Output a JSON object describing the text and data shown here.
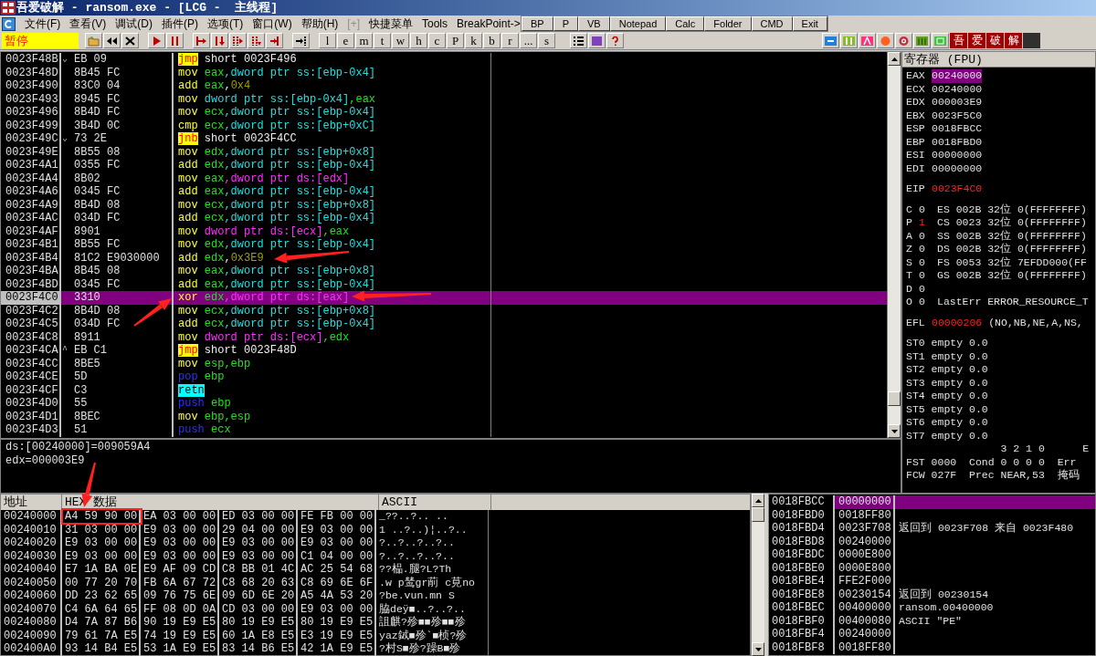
{
  "window": {
    "title": "吾爱破解 - ransom.exe - [LCG -  主线程]"
  },
  "menu": [
    {
      "label": "文件(F)",
      "disabled": false
    },
    {
      "label": "查看(V)",
      "disabled": false
    },
    {
      "label": "调试(D)",
      "disabled": false
    },
    {
      "label": "插件(P)",
      "disabled": false
    },
    {
      "label": "选项(T)",
      "disabled": false
    },
    {
      "label": "窗口(W)",
      "disabled": false
    },
    {
      "label": "帮助(H)",
      "disabled": false
    },
    {
      "label": "[+]",
      "disabled": true
    },
    {
      "label": "快捷菜单",
      "disabled": false
    },
    {
      "label": "Tools",
      "disabled": false
    },
    {
      "label": "BreakPoint->",
      "disabled": false
    }
  ],
  "status": "暂停",
  "letter_buttons": [
    "l",
    "e",
    "m",
    "t",
    "w",
    "h",
    "c",
    "P",
    "k",
    "b",
    "r",
    "...",
    "s"
  ],
  "logo_buttons": [
    "吾",
    "爱",
    "破",
    "解"
  ],
  "quick_buttons": [
    "BP",
    "P",
    "VB",
    "Notepad",
    "Calc",
    "Folder",
    "CMD",
    "Exit"
  ],
  "disassembly": [
    {
      "address": "0023F48B",
      "hex": "EB 09",
      "mark": "⌄",
      "selected": false,
      "ins": [
        {
          "text": "jmp",
          "kind": "jump"
        },
        {
          "text": " short 0023F496",
          "kind": "plain"
        }
      ]
    },
    {
      "address": "0023F48D",
      "hex": "8B45 FC",
      "selected": false,
      "ins": [
        {
          "text": "mov",
          "kind": "mnemonic"
        },
        {
          "text": " eax",
          "kind": "register"
        },
        {
          "text": ",dword ptr ss:[ebp-0x4]",
          "kind": "stackmem"
        }
      ]
    },
    {
      "address": "0023F490",
      "hex": "83C0 04",
      "selected": false,
      "ins": [
        {
          "text": "add",
          "kind": "mnemonic"
        },
        {
          "text": " eax",
          "kind": "register"
        },
        {
          "text": ",",
          "kind": "plain"
        },
        {
          "text": "0x4",
          "kind": "number"
        }
      ]
    },
    {
      "address": "0023F493",
      "hex": "8945 FC",
      "selected": false,
      "ins": [
        {
          "text": "mov",
          "kind": "mnemonic"
        },
        {
          "text": " dword ptr ss:[ebp-0x4]",
          "kind": "stackmem"
        },
        {
          "text": ",eax",
          "kind": "register"
        }
      ]
    },
    {
      "address": "0023F496",
      "hex": "8B4D FC",
      "selected": false,
      "ins": [
        {
          "text": "mov",
          "kind": "mnemonic"
        },
        {
          "text": " ecx",
          "kind": "register"
        },
        {
          "text": ",dword ptr ss:[ebp-0x4]",
          "kind": "stackmem"
        }
      ]
    },
    {
      "address": "0023F499",
      "hex": "3B4D 0C",
      "selected": false,
      "ins": [
        {
          "text": "cmp",
          "kind": "mnemonic"
        },
        {
          "text": " ecx",
          "kind": "register"
        },
        {
          "text": ",dword ptr ss:[ebp+0xC]",
          "kind": "stackmem"
        }
      ]
    },
    {
      "address": "0023F49C",
      "hex": "73 2E",
      "mark": "⌄",
      "selected": false,
      "ins": [
        {
          "text": "jnb",
          "kind": "jump"
        },
        {
          "text": " short 0023F4CC",
          "kind": "plain"
        }
      ]
    },
    {
      "address": "0023F49E",
      "hex": "8B55 08",
      "selected": false,
      "ins": [
        {
          "text": "mov",
          "kind": "mnemonic"
        },
        {
          "text": " edx",
          "kind": "register"
        },
        {
          "text": ",dword ptr ss:[ebp+0x8]",
          "kind": "stackmem"
        }
      ]
    },
    {
      "address": "0023F4A1",
      "hex": "0355 FC",
      "selected": false,
      "ins": [
        {
          "text": "add",
          "kind": "mnemonic"
        },
        {
          "text": " edx",
          "kind": "register"
        },
        {
          "text": ",dword ptr ss:[ebp-0x4]",
          "kind": "stackmem"
        }
      ]
    },
    {
      "address": "0023F4A4",
      "hex": "8B02",
      "selected": false,
      "ins": [
        {
          "text": "mov",
          "kind": "mnemonic"
        },
        {
          "text": " eax",
          "kind": "register"
        },
        {
          "text": ",dword ptr ds:[edx]",
          "kind": "datamem"
        }
      ]
    },
    {
      "address": "0023F4A6",
      "hex": "0345 FC",
      "selected": false,
      "ins": [
        {
          "text": "add",
          "kind": "mnemonic"
        },
        {
          "text": " eax",
          "kind": "register"
        },
        {
          "text": ",dword ptr ss:[ebp-0x4]",
          "kind": "stackmem"
        }
      ]
    },
    {
      "address": "0023F4A9",
      "hex": "8B4D 08",
      "selected": false,
      "ins": [
        {
          "text": "mov",
          "kind": "mnemonic"
        },
        {
          "text": " ecx",
          "kind": "register"
        },
        {
          "text": ",dword ptr ss:[ebp+0x8]",
          "kind": "stackmem"
        }
      ]
    },
    {
      "address": "0023F4AC",
      "hex": "034D FC",
      "selected": false,
      "ins": [
        {
          "text": "add",
          "kind": "mnemonic"
        },
        {
          "text": " ecx",
          "kind": "register"
        },
        {
          "text": ",dword ptr ss:[ebp-0x4]",
          "kind": "stackmem"
        }
      ]
    },
    {
      "address": "0023F4AF",
      "hex": "8901",
      "selected": false,
      "ins": [
        {
          "text": "mov",
          "kind": "mnemonic"
        },
        {
          "text": " dword ptr ds:[ecx]",
          "kind": "datamem"
        },
        {
          "text": ",eax",
          "kind": "register"
        }
      ]
    },
    {
      "address": "0023F4B1",
      "hex": "8B55 FC",
      "selected": false,
      "ins": [
        {
          "text": "mov",
          "kind": "mnemonic"
        },
        {
          "text": " edx",
          "kind": "register"
        },
        {
          "text": ",dword ptr ss:[ebp-0x4]",
          "kind": "stackmem"
        }
      ]
    },
    {
      "address": "0023F4B4",
      "hex": "81C2 E9030000",
      "selected": false,
      "ins": [
        {
          "text": "add",
          "kind": "mnemonic"
        },
        {
          "text": " edx",
          "kind": "register"
        },
        {
          "text": ",",
          "kind": "plain"
        },
        {
          "text": "0x3E9",
          "kind": "number"
        }
      ]
    },
    {
      "address": "0023F4BA",
      "hex": "8B45 08",
      "selected": false,
      "ins": [
        {
          "text": "mov",
          "kind": "mnemonic"
        },
        {
          "text": " eax",
          "kind": "register"
        },
        {
          "text": ",dword ptr ss:[ebp+0x8]",
          "kind": "stackmem"
        }
      ]
    },
    {
      "address": "0023F4BD",
      "hex": "0345 FC",
      "selected": false,
      "ins": [
        {
          "text": "add",
          "kind": "mnemonic"
        },
        {
          "text": " eax",
          "kind": "register"
        },
        {
          "text": ",dword ptr ss:[ebp-0x4]",
          "kind": "stackmem"
        }
      ]
    },
    {
      "address": "0023F4C0",
      "hex": "3310",
      "selected": true,
      "ins": [
        {
          "text": "xor",
          "kind": "mnemonic"
        },
        {
          "text": " edx",
          "kind": "register"
        },
        {
          "text": ",dword ptr ds:[eax]",
          "kind": "datamem"
        }
      ]
    },
    {
      "address": "0023F4C2",
      "hex": "8B4D 08",
      "selected": false,
      "ins": [
        {
          "text": "mov",
          "kind": "mnemonic"
        },
        {
          "text": " ecx",
          "kind": "register"
        },
        {
          "text": ",dword ptr ss:[ebp+0x8]",
          "kind": "stackmem"
        }
      ]
    },
    {
      "address": "0023F4C5",
      "hex": "034D FC",
      "selected": false,
      "ins": [
        {
          "text": "add",
          "kind": "mnemonic"
        },
        {
          "text": " ecx",
          "kind": "register"
        },
        {
          "text": ",dword ptr ss:[ebp-0x4]",
          "kind": "stackmem"
        }
      ]
    },
    {
      "address": "0023F4C8",
      "hex": "8911",
      "selected": false,
      "ins": [
        {
          "text": "mov",
          "kind": "mnemonic"
        },
        {
          "text": " dword ptr ds:[ecx]",
          "kind": "datamem"
        },
        {
          "text": ",edx",
          "kind": "register"
        }
      ]
    },
    {
      "address": "0023F4CA",
      "hex": "EB C1",
      "mark": "^",
      "selected": false,
      "ins": [
        {
          "text": "jmp",
          "kind": "jump"
        },
        {
          "text": " short 0023F48D",
          "kind": "plain"
        }
      ]
    },
    {
      "address": "0023F4CC",
      "hex": "8BE5",
      "selected": false,
      "ins": [
        {
          "text": "mov",
          "kind": "mnemonic"
        },
        {
          "text": " esp,ebp",
          "kind": "register"
        }
      ]
    },
    {
      "address": "0023F4CE",
      "hex": "5D",
      "selected": false,
      "ins": [
        {
          "text": "pop",
          "kind": "stackop"
        },
        {
          "text": " ebp",
          "kind": "register"
        }
      ]
    },
    {
      "address": "0023F4CF",
      "hex": "C3",
      "selected": false,
      "ins": [
        {
          "text": "retn",
          "kind": "return"
        }
      ]
    },
    {
      "address": "0023F4D0",
      "hex": "55",
      "selected": false,
      "ins": [
        {
          "text": "push",
          "kind": "stackop"
        },
        {
          "text": " ebp",
          "kind": "register"
        }
      ]
    },
    {
      "address": "0023F4D1",
      "hex": "8BEC",
      "selected": false,
      "ins": [
        {
          "text": "mov",
          "kind": "mnemonic"
        },
        {
          "text": " ebp,esp",
          "kind": "register"
        }
      ]
    },
    {
      "address": "0023F4D3",
      "hex": "51",
      "selected": false,
      "ins": [
        {
          "text": "push",
          "kind": "stackop"
        },
        {
          "text": " ecx",
          "kind": "register"
        }
      ]
    }
  ],
  "info": [
    "ds:[00240000]=009059A4",
    "edx=000003E9"
  ],
  "registers": {
    "title": "寄存器 (FPU)",
    "general": [
      {
        "name": "EAX",
        "value": "00240000",
        "selected": true,
        "changed": false
      },
      {
        "name": "ECX",
        "value": "00240000",
        "selected": false,
        "changed": false
      },
      {
        "name": "EDX",
        "value": "000003E9",
        "selected": false,
        "changed": false
      },
      {
        "name": "EBX",
        "value": "0023F5C0",
        "selected": false,
        "changed": false
      },
      {
        "name": "ESP",
        "value": "0018FBCC",
        "selected": false,
        "changed": false
      },
      {
        "name": "EBP",
        "value": "0018FBD0",
        "selected": false,
        "changed": false
      },
      {
        "name": "ESI",
        "value": "00000000",
        "selected": false,
        "changed": false
      },
      {
        "name": "EDI",
        "value": "00000000",
        "selected": false,
        "changed": false
      }
    ],
    "eip": {
      "name": "EIP",
      "value": "0023F4C0",
      "selected": false,
      "changed": true
    },
    "flags": [
      {
        "flag": "C",
        "value": "0",
        "changed": false,
        "detail": "ES 002B 32位 0(FFFFFFFF)"
      },
      {
        "flag": "P",
        "value": "1",
        "changed": true,
        "detail": "CS 0023 32位 0(FFFFFFFF)"
      },
      {
        "flag": "A",
        "value": "0",
        "changed": false,
        "detail": "SS 002B 32位 0(FFFFFFFF)"
      },
      {
        "flag": "Z",
        "value": "0",
        "changed": false,
        "detail": "DS 002B 32位 0(FFFFFFFF)"
      },
      {
        "flag": "S",
        "value": "0",
        "changed": false,
        "detail": "FS 0053 32位 7EFDD000(FF"
      },
      {
        "flag": "T",
        "value": "0",
        "changed": false,
        "detail": "GS 002B 32位 0(FFFFFFFF)"
      },
      {
        "flag": "D",
        "value": "0",
        "changed": false
      },
      {
        "flag": "O",
        "value": "0",
        "changed": false,
        "detail": "LastErr ERROR_RESOURCE_T"
      }
    ],
    "efl": {
      "name": "EFL",
      "value": "00000206",
      "changed": true,
      "detail": "(NO,NB,NE,A,NS,"
    },
    "fpu_stack": [
      "ST0 empty 0.0",
      "ST1 empty 0.0",
      "ST2 empty 0.0",
      "ST3 empty 0.0",
      "ST4 empty 0.0",
      "ST5 empty 0.0",
      "ST6 empty 0.0",
      "ST7 empty 0.0"
    ],
    "fpu_status": [
      "               3 2 1 0      E",
      "FST 0000  Cond 0 0 0 0  Err",
      "FCW 027F  Prec NEAR,53  掩码"
    ]
  },
  "dump": {
    "columns": [
      "地址",
      "HEX 数据",
      "ASCII"
    ],
    "rows": [
      {
        "address": "00240000",
        "hex": [
          "A4 59 90 00",
          "EA 03 00 00",
          "ED 03 00 00",
          "FE FB 00 00"
        ],
        "ascii": "_??..?..  .."
      },
      {
        "address": "00240010",
        "hex": [
          "31 03 00 00",
          "E9 03 00 00",
          "29 04 00 00",
          "E9 03 00 00"
        ],
        "ascii": "1 ..?..)¦..?.."
      },
      {
        "address": "00240020",
        "hex": [
          "E9 03 00 00",
          "E9 03 00 00",
          "E9 03 00 00",
          "E9 03 00 00"
        ],
        "ascii": "?..?..?..?.."
      },
      {
        "address": "00240030",
        "hex": [
          "E9 03 00 00",
          "E9 03 00 00",
          "E9 03 00 00",
          "C1 04 00 00"
        ],
        "ascii": "?..?..?..?.."
      },
      {
        "address": "00240040",
        "hex": [
          "E7 1A BA 0E",
          "E9 AF 09 CD",
          "C8 BB 01 4C",
          "AC 25 54 68"
        ],
        "ascii": "??榀.腿?L?Th"
      },
      {
        "address": "00240050",
        "hex": [
          "00 77 20 70",
          "FB 6A 67 72",
          "C8 68 20 63",
          "C8 69 6E 6F"
        ],
        "ascii": ".w p鸶gr萷 c莧no"
      },
      {
        "address": "00240060",
        "hex": [
          "DD 23 62 65",
          "09 76 75 6E",
          "09 6D 6E 20",
          "A5 4A 53 20"
        ],
        "ascii": "?be.vun.mn   S"
      },
      {
        "address": "00240070",
        "hex": [
          "C4 6A 64 65",
          "FF 08 0D 0A",
          "CD 03 00 00",
          "E9 03 00 00"
        ],
        "ascii": "脇deÿ■..?..?.."
      },
      {
        "address": "00240080",
        "hex": [
          "D4 7A 87 B6",
          "90 19 E9 E5",
          "80 19 E9 E5",
          "80 19 E9 E5"
        ],
        "ascii": "詛麒?殄■■殄■■殄"
      },
      {
        "address": "00240090",
        "hex": [
          "79 61 7A E5",
          "74 19 E9 E5",
          "60 1A E8 E5",
          "E3 19 E9 E5"
        ],
        "ascii": "yaz鋱■殄`■桢?殄"
      },
      {
        "address": "002400A0",
        "hex": [
          "93 14 B4 E5",
          "53 1A E9 E5",
          "83 14 B6 E5",
          "42 1A E9 E5"
        ],
        "ascii": "?村S■殄?躁B■殄"
      }
    ]
  },
  "stack": [
    {
      "address": "0018FBCC",
      "value": "00000000",
      "selected": true
    },
    {
      "address": "0018FBD0",
      "value": "0018FF80",
      "selected": false
    },
    {
      "address": "0018FBD4",
      "value": "0023F708",
      "comment": "返回到 0023F708 来自 0023F480",
      "selected": false
    },
    {
      "address": "0018FBD8",
      "value": "00240000",
      "selected": false
    },
    {
      "address": "0018FBDC",
      "value": "0000E800",
      "selected": false
    },
    {
      "address": "0018FBE0",
      "value": "0000E800",
      "selected": false
    },
    {
      "address": "0018FBE4",
      "value": "FFE2F000",
      "selected": false
    },
    {
      "address": "0018FBE8",
      "value": "00230154",
      "comment": "返回到 00230154",
      "selected": false
    },
    {
      "address": "0018FBEC",
      "value": "00400000",
      "comment": "ransom.00400000",
      "selected": false
    },
    {
      "address": "0018FBF0",
      "value": "00400080",
      "comment": "ASCII \"PE\"",
      "selected": false
    },
    {
      "address": "0018FBF4",
      "value": "00240000",
      "selected": false
    },
    {
      "address": "0018FBF8",
      "value": "0018FF80",
      "selected": false
    }
  ]
}
